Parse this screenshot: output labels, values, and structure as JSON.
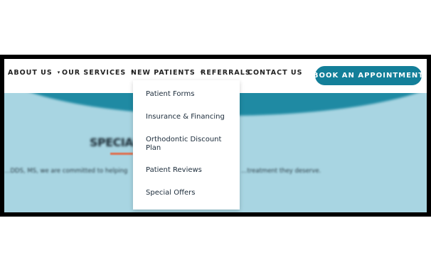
{
  "nav": {
    "items": [
      {
        "label": "ABOUT US",
        "has_caret": true
      },
      {
        "label": "OUR SERVICES",
        "has_caret": true
      },
      {
        "label": "NEW PATIENTS",
        "has_caret": true
      },
      {
        "label": "REFERRALS",
        "has_caret": false
      },
      {
        "label": "CONTACT US",
        "has_caret": false
      }
    ],
    "caret_icon": "▾",
    "cta_label": "BOOK AN APPOINTMENT"
  },
  "dropdown": {
    "items": [
      "Patient Forms",
      "Insurance & Financing",
      "Orthodontic Discount Plan",
      "Patient Reviews",
      "Special Offers"
    ]
  },
  "hero": {
    "heading": "SPECIAL",
    "text_left": "…DDS, MS, we are committed to helping",
    "text_right": "…treatment they deserve."
  },
  "colors": {
    "brand_teal": "#137f99",
    "hero_background": "#a8d5e2",
    "accent": "#e06d4b"
  }
}
